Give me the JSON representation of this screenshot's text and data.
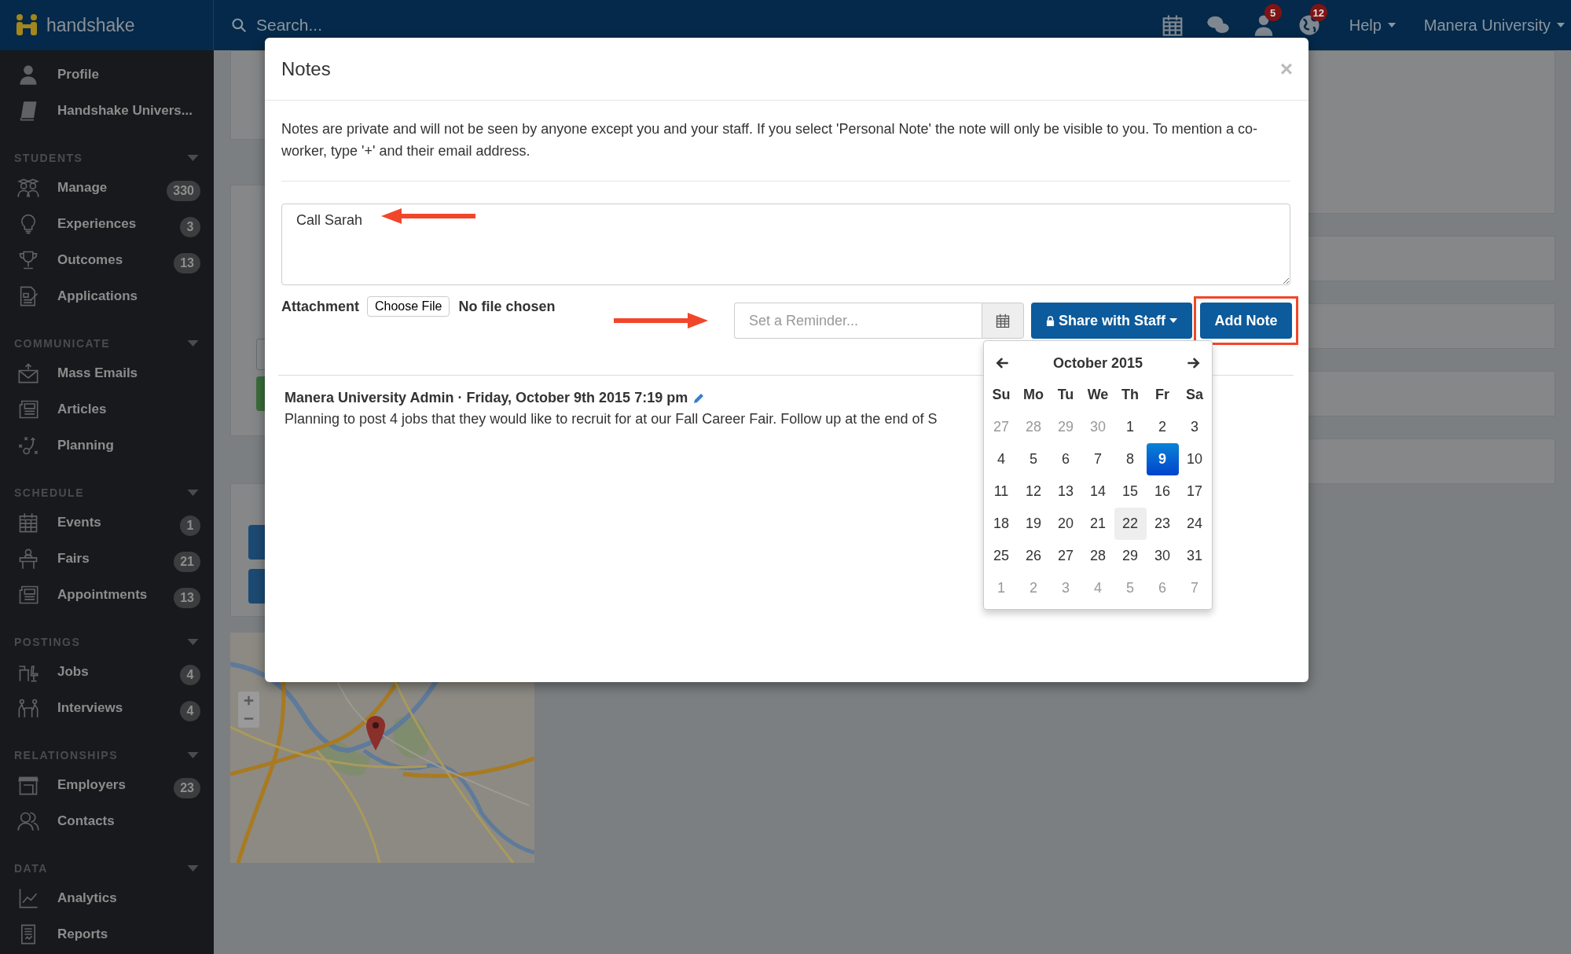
{
  "topbar": {
    "brand": "handshake",
    "search": {
      "placeholder": "Search..."
    },
    "icons": [
      {
        "kind": "calendar"
      },
      {
        "kind": "chat"
      },
      {
        "kind": "person",
        "badge": "5"
      },
      {
        "kind": "globe",
        "badge": "12"
      }
    ],
    "menus": [
      {
        "label": "Help"
      },
      {
        "label": "Manera University"
      }
    ]
  },
  "sidebar": {
    "items": [
      {
        "kind": "person",
        "label": "Profile"
      },
      {
        "kind": "book",
        "label": "Handshake Univers..."
      }
    ],
    "sections": [
      {
        "title": "STUDENTS",
        "expanded": true,
        "items": [
          {
            "kind": "graduates",
            "label": "Manage",
            "badge": "330"
          },
          {
            "kind": "bulb",
            "label": "Experiences",
            "badge": "3"
          },
          {
            "kind": "trophy",
            "label": "Outcomes",
            "badge": "13"
          },
          {
            "kind": "document",
            "label": "Applications"
          }
        ]
      },
      {
        "title": "COMMUNICATE",
        "expanded": true,
        "items": [
          {
            "kind": "envelope",
            "label": "Mass Emails"
          },
          {
            "kind": "newspaper",
            "label": "Articles"
          },
          {
            "kind": "plays",
            "label": "Planning"
          }
        ]
      },
      {
        "title": "SCHEDULE",
        "expanded": true,
        "items": [
          {
            "kind": "calendar",
            "label": "Events",
            "badge": "1"
          },
          {
            "kind": "podium",
            "label": "Fairs",
            "badge": "21"
          },
          {
            "kind": "newspaper",
            "label": "Appointments",
            "badge": "13"
          }
        ]
      },
      {
        "title": "POSTINGS",
        "expanded": true,
        "items": [
          {
            "kind": "desk",
            "label": "Jobs",
            "badge": "4"
          },
          {
            "kind": "meeting",
            "label": "Interviews",
            "badge": "4"
          }
        ]
      },
      {
        "title": "RELATIONSHIPS",
        "expanded": true,
        "items": [
          {
            "kind": "storefront",
            "label": "Employers",
            "badge": "23"
          },
          {
            "kind": "people",
            "label": "Contacts"
          }
        ]
      },
      {
        "title": "DATA",
        "expanded": true,
        "items": [
          {
            "kind": "chart",
            "label": "Analytics"
          },
          {
            "kind": "report",
            "label": "Reports"
          }
        ]
      }
    ]
  },
  "modal": {
    "title": "Notes",
    "close": "×",
    "description": "Notes are private and will not be seen by anyone except you and your staff. If you select 'Personal Note' the note will only be visible to you. To mention a co-worker, type '+' and their email address.",
    "note_field": {
      "value": "Call Sarah"
    },
    "attachment": {
      "label": "Attachment",
      "button": "Choose File",
      "status": "No file chosen"
    },
    "reminder": {
      "placeholder": "Set a Reminder..."
    },
    "share_button": {
      "label": "Share with Staff"
    },
    "add_button": {
      "label": "Add Note",
      "highlighted": true
    },
    "annotations": [
      {
        "kind": "left_arrow"
      },
      {
        "kind": "right_arrow"
      }
    ],
    "notes": [
      {
        "meta": "Manera University Admin · Friday, October 9th 2015 7:19 pm",
        "text": "Planning to post 4 jobs that they would like to recruit for at our Fall Career Fair. Follow up at the end of S"
      }
    ],
    "datepicker": {
      "title": "October 2015",
      "weekdays": [
        "Su",
        "Mo",
        "Tu",
        "We",
        "Th",
        "Fr",
        "Sa"
      ],
      "days": [
        {
          "label": "27",
          "outside": true,
          "selected": false,
          "hovered": false
        },
        {
          "label": "28",
          "outside": true,
          "selected": false,
          "hovered": false
        },
        {
          "label": "29",
          "outside": true,
          "selected": false,
          "hovered": false
        },
        {
          "label": "30",
          "outside": true,
          "selected": false,
          "hovered": false
        },
        {
          "label": "1",
          "outside": false,
          "selected": false,
          "hovered": false
        },
        {
          "label": "2",
          "outside": false,
          "selected": false,
          "hovered": false
        },
        {
          "label": "3",
          "outside": false,
          "selected": false,
          "hovered": false
        },
        {
          "label": "4",
          "outside": false,
          "selected": false,
          "hovered": false
        },
        {
          "label": "5",
          "outside": false,
          "selected": false,
          "hovered": false
        },
        {
          "label": "6",
          "outside": false,
          "selected": false,
          "hovered": false
        },
        {
          "label": "7",
          "outside": false,
          "selected": false,
          "hovered": false
        },
        {
          "label": "8",
          "outside": false,
          "selected": false,
          "hovered": false
        },
        {
          "label": "9",
          "outside": false,
          "selected": true,
          "hovered": false
        },
        {
          "label": "10",
          "outside": false,
          "selected": false,
          "hovered": false
        },
        {
          "label": "11",
          "outside": false,
          "selected": false,
          "hovered": false
        },
        {
          "label": "12",
          "outside": false,
          "selected": false,
          "hovered": false
        },
        {
          "label": "13",
          "outside": false,
          "selected": false,
          "hovered": false
        },
        {
          "label": "14",
          "outside": false,
          "selected": false,
          "hovered": false
        },
        {
          "label": "15",
          "outside": false,
          "selected": false,
          "hovered": false
        },
        {
          "label": "16",
          "outside": false,
          "selected": false,
          "hovered": false
        },
        {
          "label": "17",
          "outside": false,
          "selected": false,
          "hovered": false
        },
        {
          "label": "18",
          "outside": false,
          "selected": false,
          "hovered": false
        },
        {
          "label": "19",
          "outside": false,
          "selected": false,
          "hovered": false
        },
        {
          "label": "20",
          "outside": false,
          "selected": false,
          "hovered": false
        },
        {
          "label": "21",
          "outside": false,
          "selected": false,
          "hovered": false
        },
        {
          "label": "22",
          "outside": false,
          "selected": false,
          "hovered": true
        },
        {
          "label": "23",
          "outside": false,
          "selected": false,
          "hovered": false
        },
        {
          "label": "24",
          "outside": false,
          "selected": false,
          "hovered": false
        },
        {
          "label": "25",
          "outside": false,
          "selected": false,
          "hovered": false
        },
        {
          "label": "26",
          "outside": false,
          "selected": false,
          "hovered": false
        },
        {
          "label": "27",
          "outside": false,
          "selected": false,
          "hovered": false
        },
        {
          "label": "28",
          "outside": false,
          "selected": false,
          "hovered": false
        },
        {
          "label": "29",
          "outside": false,
          "selected": false,
          "hovered": false
        },
        {
          "label": "30",
          "outside": false,
          "selected": false,
          "hovered": false
        },
        {
          "label": "31",
          "outside": false,
          "selected": false,
          "hovered": false
        },
        {
          "label": "1",
          "outside": true,
          "selected": false,
          "hovered": false
        },
        {
          "label": "2",
          "outside": true,
          "selected": false,
          "hovered": false
        },
        {
          "label": "3",
          "outside": true,
          "selected": false,
          "hovered": false
        },
        {
          "label": "4",
          "outside": true,
          "selected": false,
          "hovered": false
        },
        {
          "label": "5",
          "outside": true,
          "selected": false,
          "hovered": false
        },
        {
          "label": "6",
          "outside": true,
          "selected": false,
          "hovered": false
        },
        {
          "label": "7",
          "outside": true,
          "selected": false,
          "hovered": false
        }
      ]
    }
  }
}
